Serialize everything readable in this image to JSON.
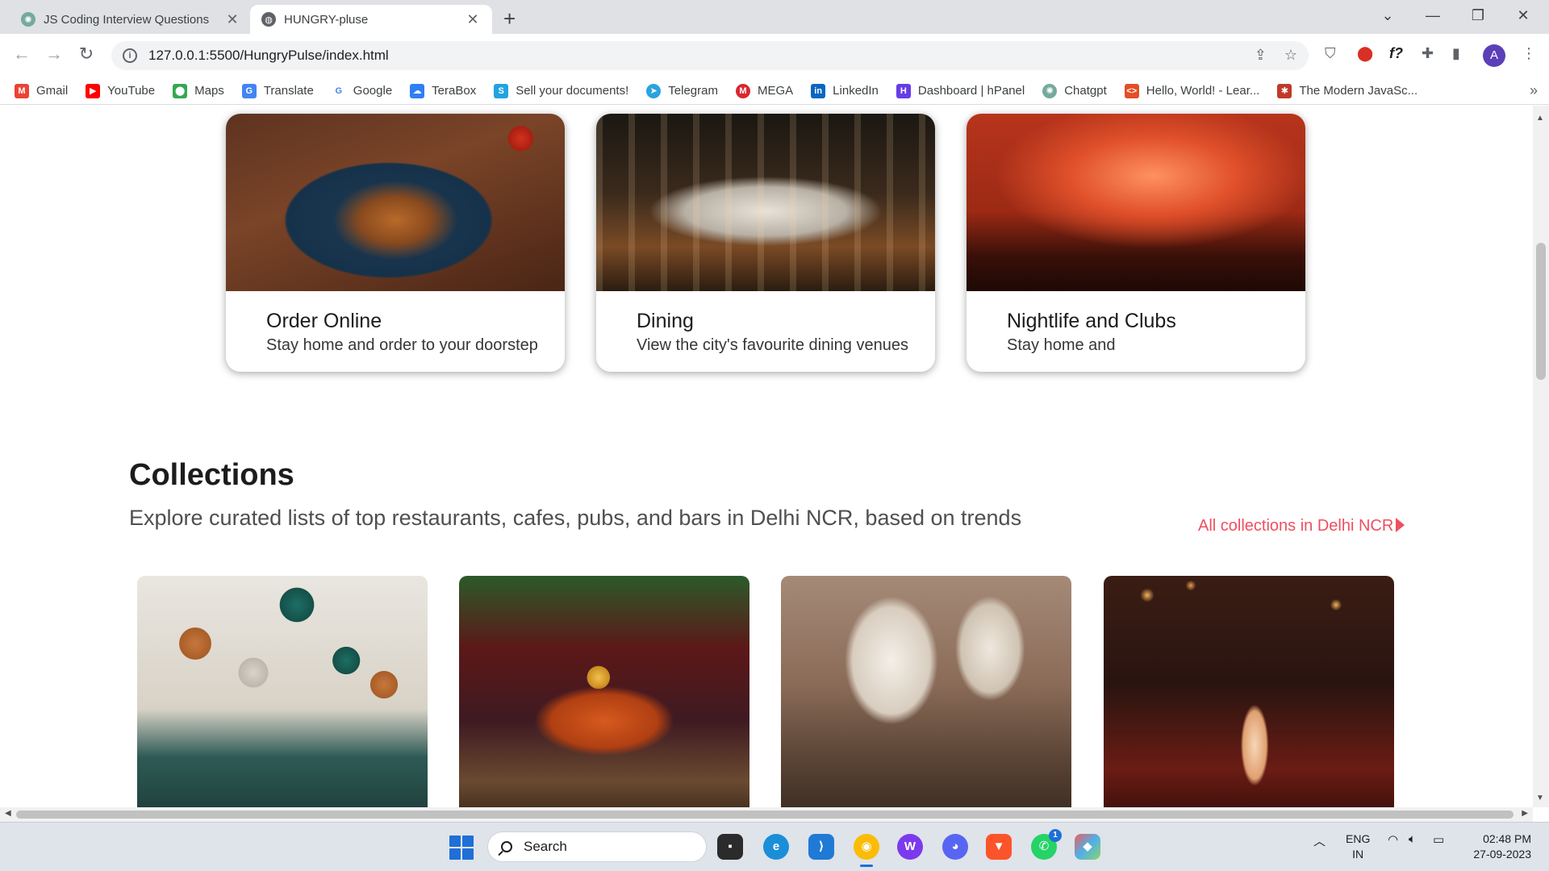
{
  "browser": {
    "tabs": [
      {
        "title": "JS Coding Interview Questions",
        "active": false,
        "icon": "chatgpt-icon"
      },
      {
        "title": "HUNGRY-pluse",
        "active": true,
        "icon": "globe-icon"
      }
    ],
    "url": "127.0.0.1:5500/HungryPulse/index.html",
    "profile_initial": "A",
    "bookmarks": [
      {
        "label": "Gmail",
        "icon": "gmail-icon",
        "color": "#ea4335"
      },
      {
        "label": "YouTube",
        "icon": "youtube-icon",
        "color": "#ff0000"
      },
      {
        "label": "Maps",
        "icon": "maps-icon",
        "color": "#34a853"
      },
      {
        "label": "Translate",
        "icon": "translate-icon",
        "color": "#4285f4"
      },
      {
        "label": "Google",
        "icon": "google-icon",
        "color": "#4285f4"
      },
      {
        "label": "TeraBox",
        "icon": "terabox-icon",
        "color": "#2f7ef5"
      },
      {
        "label": "Sell your documents!",
        "icon": "document-icon",
        "color": "#22a3e0"
      },
      {
        "label": "Telegram",
        "icon": "telegram-icon",
        "color": "#2aa3df"
      },
      {
        "label": "MEGA",
        "icon": "mega-icon",
        "color": "#d9272e"
      },
      {
        "label": "LinkedIn",
        "icon": "linkedin-icon",
        "color": "#0a66c2"
      },
      {
        "label": "Dashboard | hPanel",
        "icon": "hostinger-icon",
        "color": "#673de6"
      },
      {
        "label": "Chatgpt",
        "icon": "chatgpt-icon",
        "color": "#74aa9c"
      },
      {
        "label": "Hello, World! - Lear...",
        "icon": "code-icon",
        "color": "#e34f26"
      },
      {
        "label": "The Modern JavaSc...",
        "icon": "javascript-icon",
        "color": "#c0392b"
      }
    ]
  },
  "page": {
    "feature_cards": [
      {
        "title": "Order Online",
        "subtitle": "Stay home and order to your doorstep"
      },
      {
        "title": "Dining",
        "subtitle": "View the city's favourite dining venues"
      },
      {
        "title": "Nightlife and Clubs",
        "subtitle": "Stay home and"
      }
    ],
    "collections": {
      "title": "Collections",
      "subtitle": "Explore curated lists of top restaurants, cafes, pubs, and bars in Delhi NCR, based on trends",
      "link": "All collections in Delhi NCR",
      "accent_color": "#ef4f5f"
    }
  },
  "taskbar": {
    "search_label": "Search",
    "whatsapp_badge": "1",
    "language": "ENG",
    "region": "IN",
    "time": "02:48 PM",
    "date": "27-09-2023"
  }
}
